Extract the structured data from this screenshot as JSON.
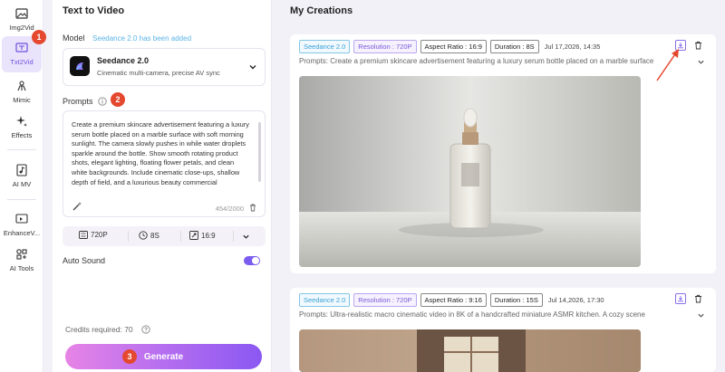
{
  "sidebar": {
    "items": [
      {
        "label": "Img2Vid"
      },
      {
        "label": "Txt2Vid"
      },
      {
        "label": "Mimic"
      },
      {
        "label": "Effects"
      },
      {
        "label": "AI MV"
      },
      {
        "label": "EnhanceV..."
      },
      {
        "label": "AI Tools"
      }
    ]
  },
  "steps": {
    "one": "1",
    "two": "2",
    "three": "3"
  },
  "panel": {
    "title": "Text to Video",
    "model_label": "Model",
    "model_added": "Seedance 2.0 has been added",
    "model_name": "Seedance 2.0",
    "model_desc": "Cinematic multi-camera, precise AV sync",
    "prompts_label": "Prompts",
    "prompt_text": "Create a premium skincare advertisement featuring a luxury serum bottle placed on a marble surface with soft morning sunlight. The camera slowly pushes in while water droplets sparkle around the bottle. Show smooth rotating product shots, elegant lighting, floating flower petals, and clean white backgrounds. Include cinematic close-ups, shallow depth of field, and a luxurious beauty commercial",
    "char_count": "454/2000",
    "options": {
      "resolution": "720P",
      "duration": "8S",
      "ratio": "16:9"
    },
    "auto_sound_label": "Auto Sound",
    "auto_sound_on": true,
    "credits": "Credits required: 70",
    "generate_label": "Generate"
  },
  "creations": {
    "title": "My Creations",
    "cards": [
      {
        "model": "Seedance 2.0",
        "resolution": "Resolution : 720P",
        "ratio": "Aspect Ratio : 16:9",
        "duration": "Duration : 8S",
        "date": "Jul 17,2026, 14:35",
        "prompt": "Prompts: Create a premium skincare advertisement featuring a luxury serum bottle placed on a marble surface"
      },
      {
        "model": "Seedance 2.0",
        "resolution": "Resolution : 720P",
        "ratio": "Aspect Ratio : 9:16",
        "duration": "Duration : 15S",
        "date": "Jul 14,2026, 17:30",
        "prompt": "Prompts: Ultra-realistic macro cinematic video in 8K of a handcrafted miniature ASMR kitchen. A cozy scene"
      }
    ]
  },
  "colors": {
    "accent": "#7b5cf0",
    "badge": "#e4482f",
    "arrow": "#e4482f"
  }
}
